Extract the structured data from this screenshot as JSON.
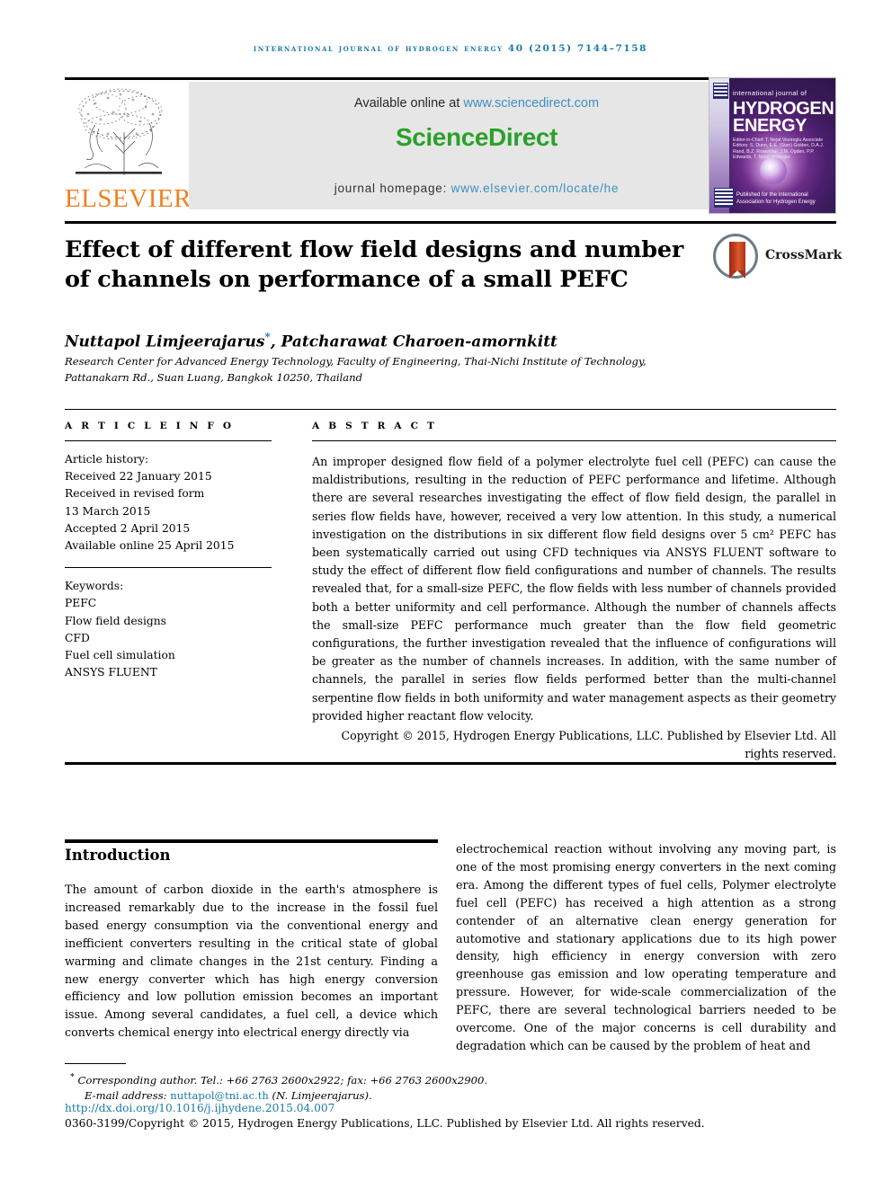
{
  "running_head": "International Journal of Hydrogen Energy 40 (2015) 7144–7158",
  "masthead": {
    "available_prefix": "Available online at ",
    "available_link": "www.sciencedirect.com",
    "sciencedirect_logo": "ScienceDirect",
    "homepage_prefix": "journal homepage: ",
    "homepage_link": "www.elsevier.com/locate/he",
    "publisher_name": "ELSEVIER",
    "publisher_colors": {
      "wordmark": "#f08122",
      "link": "#3e8fc0",
      "sciencedirect_green": "#2ca02a",
      "running_head_blue": "#1a7aa8"
    },
    "cover": {
      "superline": "international journal of",
      "line1": "HYDROGEN",
      "line2": "ENERGY",
      "editors": "Editor-in-Chief: T. Nejat Veziroglu   Associate Editors: S. Dunn, E.E. (Stan) Golden, D.A.J. Rand, B.Z. Rosenthal, J.M. Ogden, P.P. Edwards, T. Nejat Veziroglu",
      "footer_text": "Published for the International Association for Hydrogen Energy"
    }
  },
  "article": {
    "title": "Effect of different flow field designs and number of channels on performance of a small PEFC",
    "crossmark_label": "CrossMark",
    "authors": "Nuttapol Limjeerajarus",
    "author_marker": "*",
    "authors_rest": ", Patcharawat Charoen-amornkitt",
    "affiliation_line1": "Research Center for Advanced Energy Technology, Faculty of Engineering, Thai-Nichi Institute of Technology,",
    "affiliation_line2": "Pattanakarn Rd., Suan Luang, Bangkok 10250, Thailand"
  },
  "article_info": {
    "heading": "A R T I C L E   I N F O",
    "history_label": "Article history:",
    "history": [
      "Received 22 January 2015",
      "Received in revised form",
      "13 March 2015",
      "Accepted 2 April 2015",
      "Available online 25 April 2015"
    ],
    "keywords_label": "Keywords:",
    "keywords": [
      "PEFC",
      "Flow field designs",
      "CFD",
      "Fuel cell simulation",
      "ANSYS FLUENT"
    ]
  },
  "abstract": {
    "heading": "A B S T R A C T",
    "body": "An improper designed flow field of a polymer electrolyte fuel cell (PEFC) can cause the maldistributions, resulting in the reduction of PEFC performance and lifetime. Although there are several researches investigating the effect of flow field design, the parallel in series flow fields have, however, received a very low attention. In this study, a numerical investigation on the distributions in six different flow field designs over 5 cm² PEFC has been systematically carried out using CFD techniques via ANSYS FLUENT software to study the effect of different flow field configurations and number of channels. The results revealed that, for a small-size PEFC, the flow fields with less number of channels provided both a better uniformity and cell performance. Although the number of channels affects the small-size PEFC performance much greater than the flow field geometric configurations, the further investigation revealed that the influence of configurations will be greater as the number of channels increases. In addition, with the same number of channels, the parallel in series flow fields performed better than the multi-channel serpentine flow fields in both uniformity and water management aspects as their geometry provided higher reactant flow velocity.",
    "copyright": "Copyright © 2015, Hydrogen Energy Publications, LLC. Published by Elsevier Ltd. All rights reserved."
  },
  "introduction": {
    "heading": "Introduction",
    "left_paragraph": "The amount of carbon dioxide in the earth's atmosphere is increased remarkably due to the increase in the fossil fuel based energy consumption via the conventional energy and inefficient converters resulting in the critical state of global warming and climate changes in the 21st century. Finding a new energy converter which has high energy conversion efficiency and low pollution emission becomes an important issue. Among several candidates, a fuel cell, a device which converts chemical energy into electrical energy directly via",
    "right_paragraph": "electrochemical reaction without involving any moving part, is one of the most promising energy converters in the next coming era. Among the different types of fuel cells, Polymer electrolyte fuel cell (PEFC) has received a high attention as a strong contender of an alternative clean energy generation for automotive and stationary applications due to its high power density, high efficiency in energy conversion with zero greenhouse gas emission and low operating temperature and pressure. However, for wide-scale commercialization of the PEFC, there are several technological barriers needed to be overcome. One of the major concerns is cell durability and degradation which can be caused by the problem of heat and"
  },
  "footer": {
    "corresponding_marker": "*",
    "corresponding_text": " Corresponding author. Tel.: +66 2763 2600x2922; fax: +66 2763 2600x2900.",
    "email_label": "E-mail address: ",
    "email": "nuttapol@tni.ac.th",
    "email_suffix": " (N. Limjeerajarus).",
    "doi": "http://dx.doi.org/10.1016/j.ijhydene.2015.04.007",
    "issn_line": "0360-3199/Copyright © 2015, Hydrogen Energy Publications, LLC. Published by Elsevier Ltd. All rights reserved."
  }
}
